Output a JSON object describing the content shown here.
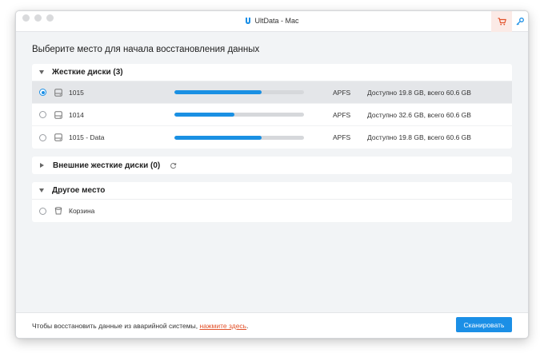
{
  "window": {
    "title": "UltData - Mac"
  },
  "heading": "Выберите место для начала восстановления данных",
  "sections": {
    "hard_drives": {
      "title": "Жесткие диски (3)",
      "rows": [
        {
          "name": "1015",
          "usage": 0.67,
          "fs": "APFS",
          "capacity": "Доступно 19.8 GB, всего 60.6 GB",
          "selected": true
        },
        {
          "name": "1014",
          "usage": 0.46,
          "fs": "APFS",
          "capacity": "Доступно 32.6 GB, всего 60.6 GB",
          "selected": false
        },
        {
          "name": "1015 - Data",
          "usage": 0.67,
          "fs": "APFS",
          "capacity": "Доступно 19.8 GB, всего 60.6 GB",
          "selected": false
        }
      ]
    },
    "external": {
      "title": "Внешние жесткие диски (0)"
    },
    "other": {
      "title": "Другое место",
      "rows": [
        {
          "name": "Корзина",
          "selected": false
        }
      ]
    }
  },
  "footer": {
    "text": "Чтобы восстановить данные из аварийной системы, ",
    "link": "нажмите здесь",
    "text_end": ".",
    "scan_label": "Сканировать"
  },
  "colors": {
    "accent": "#1b8fe6",
    "link": "#e2522b",
    "cart": "#e2522b"
  },
  "icons": {
    "cart": "cart-icon",
    "key": "key-icon",
    "refresh": "refresh-icon",
    "drive": "hard-drive-icon",
    "trash": "trash-icon"
  }
}
